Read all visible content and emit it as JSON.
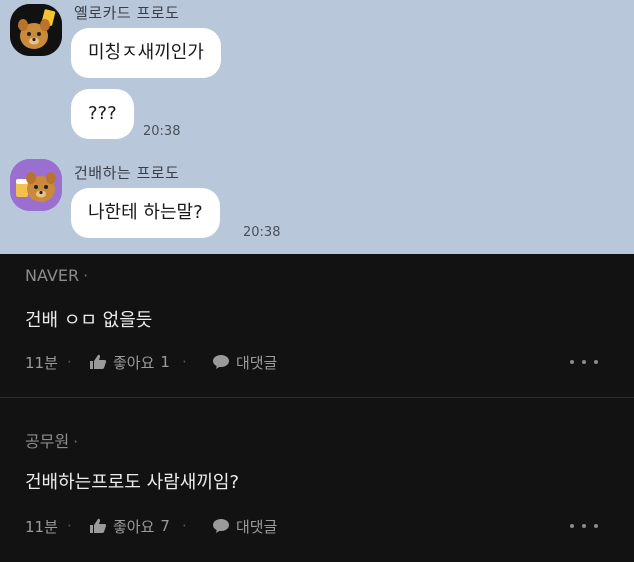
{
  "chat": {
    "messages_group_1": {
      "sender": "옐로카드 프로도",
      "bubbles": [
        "미칭ㅈ새끼인가",
        "???"
      ],
      "time": "20:38"
    },
    "messages_group_2": {
      "sender": "건배하는 프로도",
      "bubbles": [
        "나한테 하는말?"
      ],
      "time": "20:38"
    }
  },
  "comments": [
    {
      "author": "NAVER",
      "text": "건배 ㅇㅁ 없을듯",
      "age": "11분",
      "like_label": "좋아요",
      "like_count": "1",
      "reply_label": "대댓글"
    },
    {
      "author": "공무원",
      "text": "건배하는프로도 사람새끼임?",
      "age": "11분",
      "like_label": "좋아요",
      "like_count": "7",
      "reply_label": "대댓글"
    }
  ],
  "colors": {
    "chat_background": "#b8c8da",
    "bubble": "#ffffff",
    "comment_background": "#121212"
  },
  "icons": [
    "yellow-card-frodo-avatar",
    "cheers-frodo-avatar",
    "thumbs-up-icon",
    "speech-bubble-icon",
    "more-dots-icon"
  ]
}
